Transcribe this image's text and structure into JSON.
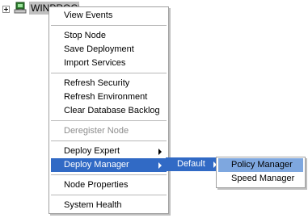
{
  "tree": {
    "node_label": "WINPROGROUPS"
  },
  "main_menu": {
    "items": [
      {
        "label": "View Events"
      },
      {
        "label": "Stop Node"
      },
      {
        "label": "Save Deployment"
      },
      {
        "label": "Import Services"
      },
      {
        "label": "Refresh Security"
      },
      {
        "label": "Refresh Environment"
      },
      {
        "label": "Clear Database Backlog"
      },
      {
        "label": "Deregister Node",
        "disabled": true
      },
      {
        "label": "Deploy Expert",
        "has_submenu": true
      },
      {
        "label": "Deploy Manager",
        "has_submenu": true,
        "active": true
      },
      {
        "label": "Node Properties"
      },
      {
        "label": "System Health"
      }
    ]
  },
  "deploy_manager_submenu": {
    "items": [
      {
        "label": "Default",
        "has_submenu": true,
        "active": true
      }
    ]
  },
  "default_submenu": {
    "items": [
      {
        "label": "Policy Manager",
        "hovered": true
      },
      {
        "label": "Speed Manager"
      }
    ]
  },
  "colors": {
    "highlight": "#316ac5",
    "hover": "#7ea7df",
    "disabled_text": "#8c8c8c",
    "node_label_bg": "#c0c0c0"
  }
}
